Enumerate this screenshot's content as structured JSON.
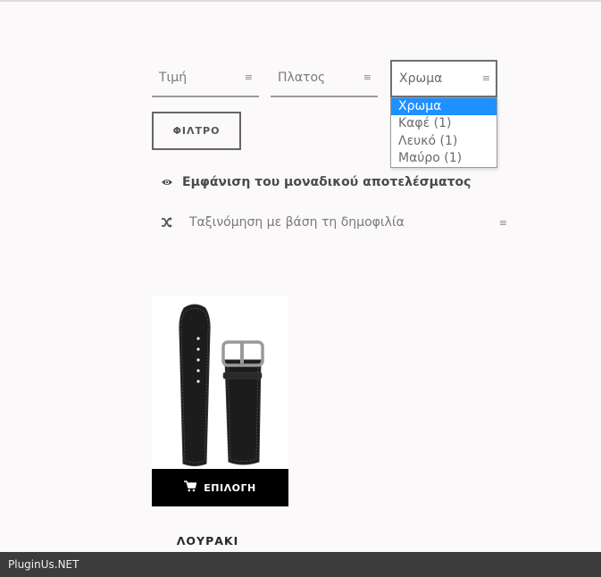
{
  "filters": {
    "price": {
      "label": "Τιμή",
      "arrows": "≡"
    },
    "width": {
      "label": "Πλατος",
      "arrows": "≡"
    },
    "color": {
      "label": "Χρωμα",
      "arrows": "≡",
      "options": [
        "Χρωμα",
        "Καφέ (1)",
        "Λευκό (1)",
        "Μαύρο (1)"
      ],
      "selected_index": 0
    },
    "filter_button_label": "ΦΙΛΤΡΟ"
  },
  "results": {
    "single_result_text": "Εμφάνιση του μοναδικού αποτελέσματος",
    "orderby_label": "Ταξινόμηση με βάση τη δημοφιλία",
    "orderby_arrows": "≡"
  },
  "product": {
    "select_label": "ΕΠΙΛΟΓΗ",
    "title": "ΛΟΥΡΑΚΙ"
  },
  "footer": {
    "text": "PluginUs.NET"
  },
  "colors": {
    "dropdown_highlight": "#1e90ff",
    "footer_bg": "#3c3c3c",
    "button_bg": "#000000"
  }
}
